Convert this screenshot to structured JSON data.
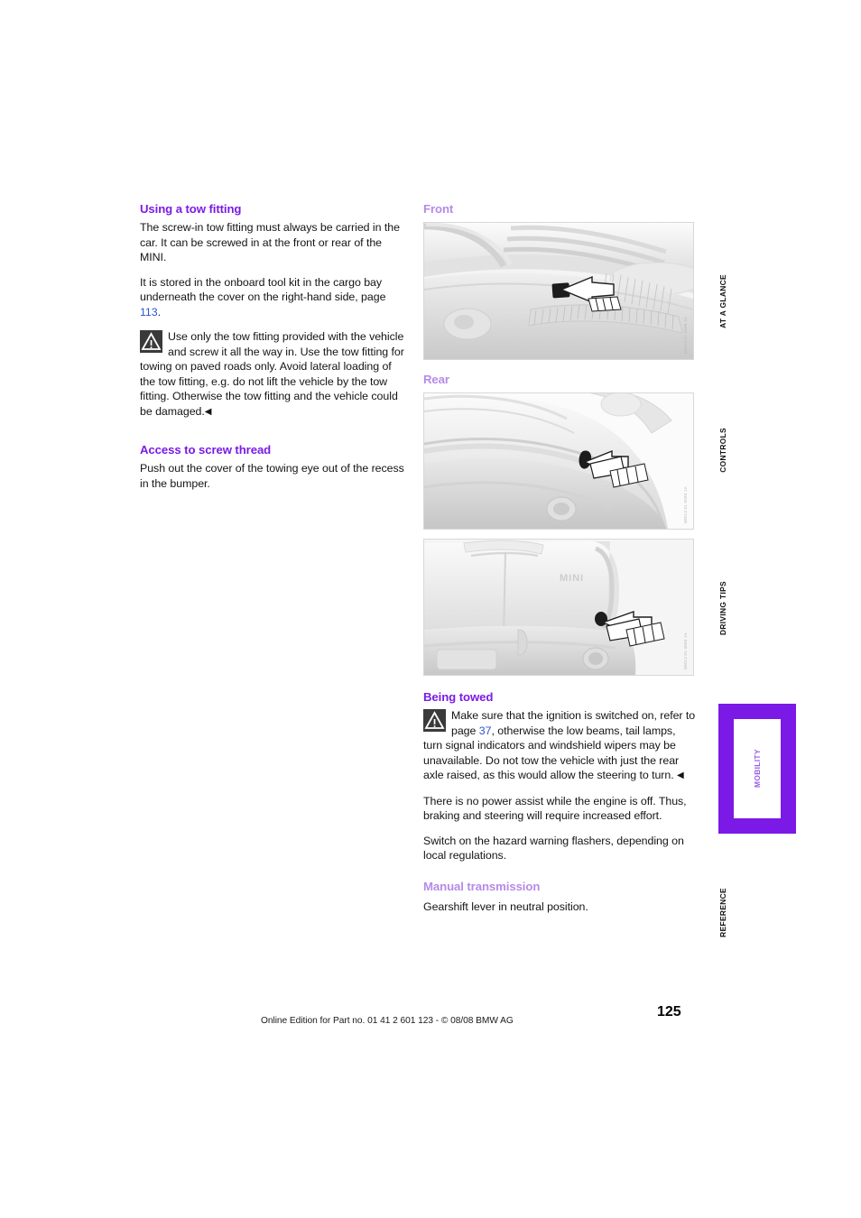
{
  "document": {
    "page_number": "125",
    "footer": "Online Edition for Part no. 01 41 2 601 123  - © 08/08 BMW AG"
  },
  "left_column": {
    "heading_1": "Using a tow fitting",
    "para_1": "The screw-in tow fitting must always be carried in the car. It can be screwed in at the front or rear of the MINI.",
    "para_2_before": "It is stored in the onboard tool kit in the cargo bay underneath the cover on the right-hand side, page ",
    "para_2_ref": "113",
    "para_2_after": ".",
    "warning_text": "Use only the tow fitting provided with the vehicle and screw it all the way in. Use the tow fitting for towing on paved roads only. Avoid lateral loading of the tow fitting, e.g. do not lift the vehicle by the tow fitting. Otherwise the tow fitting and the vehicle could be damaged.",
    "warning_endmark": "◀",
    "heading_2": "Access to screw thread",
    "para_3": "Push out the cover of the towing eye out of the recess in the bumper."
  },
  "right_column": {
    "heading_front": "Front",
    "heading_rear": "Rear",
    "figure_front_code": "MW13 01 0096 1A",
    "figure_rear1_code": "MW13 01 0093 1A",
    "figure_rear2_code": "MW13 01 0094 1A",
    "heading_being_towed": "Being towed",
    "warning_before_ref": "Make sure that the ignition is switched on, refer to page ",
    "warning_ref": "37",
    "warning_after_ref": ", otherwise the low beams, tail lamps, turn signal indicators and windshield wipers may be unavailable. Do not tow the vehicle with just the rear axle raised, as this would allow the steering to turn. ",
    "warning_endmark": "◀",
    "para_1": "There is no power assist while the engine is off. Thus, braking and steering will require increased effort.",
    "para_2": "Switch on the hazard warning flashers, depending on local regulations.",
    "heading_manual": "Manual transmission",
    "para_3": "Gearshift lever in neutral position."
  },
  "tab_rail": {
    "items": [
      {
        "label": "AT A GLANCE",
        "active": false
      },
      {
        "label": "CONTROLS",
        "active": false
      },
      {
        "label": "DRIVING TIPS",
        "active": false
      },
      {
        "label": "MOBILITY",
        "active": true
      },
      {
        "label": "REFERENCE",
        "active": false
      }
    ]
  },
  "colors": {
    "heading_bold": "#7b1ae6",
    "heading_light": "#b58ae8",
    "page_ref_link": "#2b55d4",
    "tab_active_border": "#7b1ae6",
    "tab_active_label": "#9a5ce8"
  }
}
